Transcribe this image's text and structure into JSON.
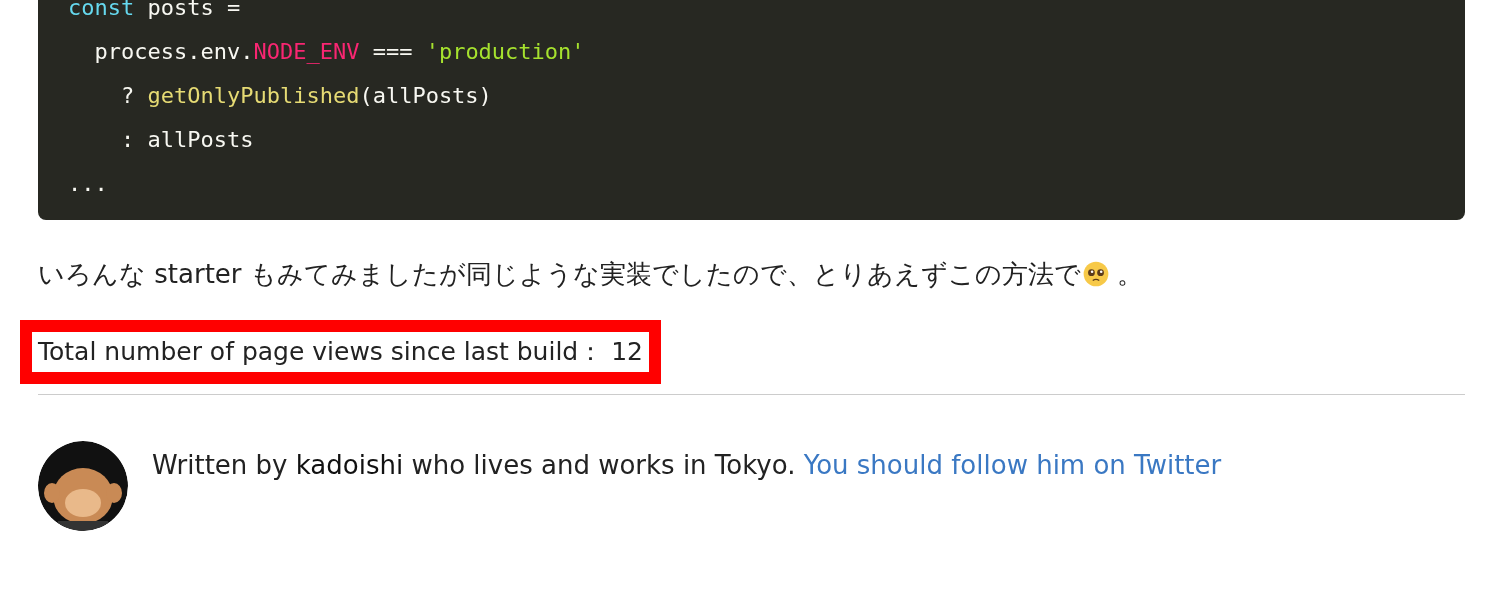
{
  "code_block": {
    "lines": [
      {
        "tokens": [
          {
            "kind": "keyword",
            "text": "const"
          },
          {
            "kind": "plain",
            "text": " posts ="
          }
        ]
      },
      {
        "tokens": [
          {
            "kind": "plain",
            "text": "  process.env."
          },
          {
            "kind": "constant",
            "text": "NODE_ENV"
          },
          {
            "kind": "plain",
            "text": " === "
          },
          {
            "kind": "string",
            "text": "'production'"
          }
        ]
      },
      {
        "tokens": [
          {
            "kind": "plain",
            "text": "    ? "
          },
          {
            "kind": "function",
            "text": "getOnlyPublished"
          },
          {
            "kind": "plain",
            "text": "(allPosts)"
          }
        ]
      },
      {
        "tokens": [
          {
            "kind": "plain",
            "text": "    : allPosts"
          }
        ]
      },
      {
        "tokens": [
          {
            "kind": "plain",
            "text": "..."
          }
        ]
      }
    ]
  },
  "paragraph": {
    "before_emoji": "いろんな starter もみてみましたが同じような実装でしたので、とりあえずこの方法で",
    "after_emoji": " 。"
  },
  "page_views": {
    "text": "Total number of page views since last build： 12",
    "highlighted": true
  },
  "author": {
    "prefix": "Written by ",
    "name": "kadoishi",
    "suffix": " who lives and works in Tokyo. ",
    "link": "You should follow him on Twitter"
  }
}
